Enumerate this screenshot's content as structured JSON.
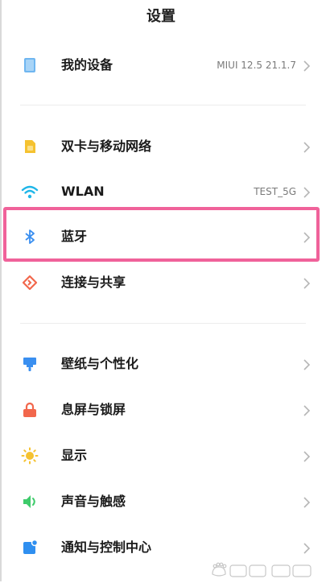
{
  "header": {
    "title": "设置"
  },
  "groups": [
    {
      "items": [
        {
          "label": "我的设备",
          "value": "MIUI 12.5 21.1.7",
          "icon": "device-icon"
        }
      ]
    },
    {
      "items": [
        {
          "label": "双卡与移动网络",
          "value": "",
          "icon": "sim-card-icon"
        },
        {
          "label": "WLAN",
          "value": "TEST_5G",
          "icon": "wifi-icon"
        },
        {
          "label": "蓝牙",
          "value": "",
          "icon": "bluetooth-icon",
          "highlighted": true
        },
        {
          "label": "连接与共享",
          "value": "",
          "icon": "connection-share-icon"
        }
      ]
    },
    {
      "items": [
        {
          "label": "壁纸与个性化",
          "value": "",
          "icon": "wallpaper-icon"
        },
        {
          "label": "息屏与锁屏",
          "value": "",
          "icon": "lock-icon"
        },
        {
          "label": "显示",
          "value": "",
          "icon": "display-brightness-icon"
        },
        {
          "label": "声音与触感",
          "value": "",
          "icon": "sound-icon"
        },
        {
          "label": "通知与控制中心",
          "value": "",
          "icon": "notification-icon"
        }
      ]
    }
  ],
  "colors": {
    "highlight_border": "#f0629a",
    "device_icon": "#6fb6f0",
    "sim_icon": "#f5c230",
    "wifi_icon": "#1fb6e8",
    "bluetooth_icon": "#3a8ff0",
    "connection_icon": "#f2674c",
    "wallpaper_icon": "#3a8ff0",
    "lock_icon": "#f2674c",
    "display_icon": "#f5c230",
    "sound_icon": "#3ecb6b",
    "notification_icon": "#2f8ff0"
  },
  "watermark": {
    "icon": "baidu-jingyan-watermark-icon"
  }
}
